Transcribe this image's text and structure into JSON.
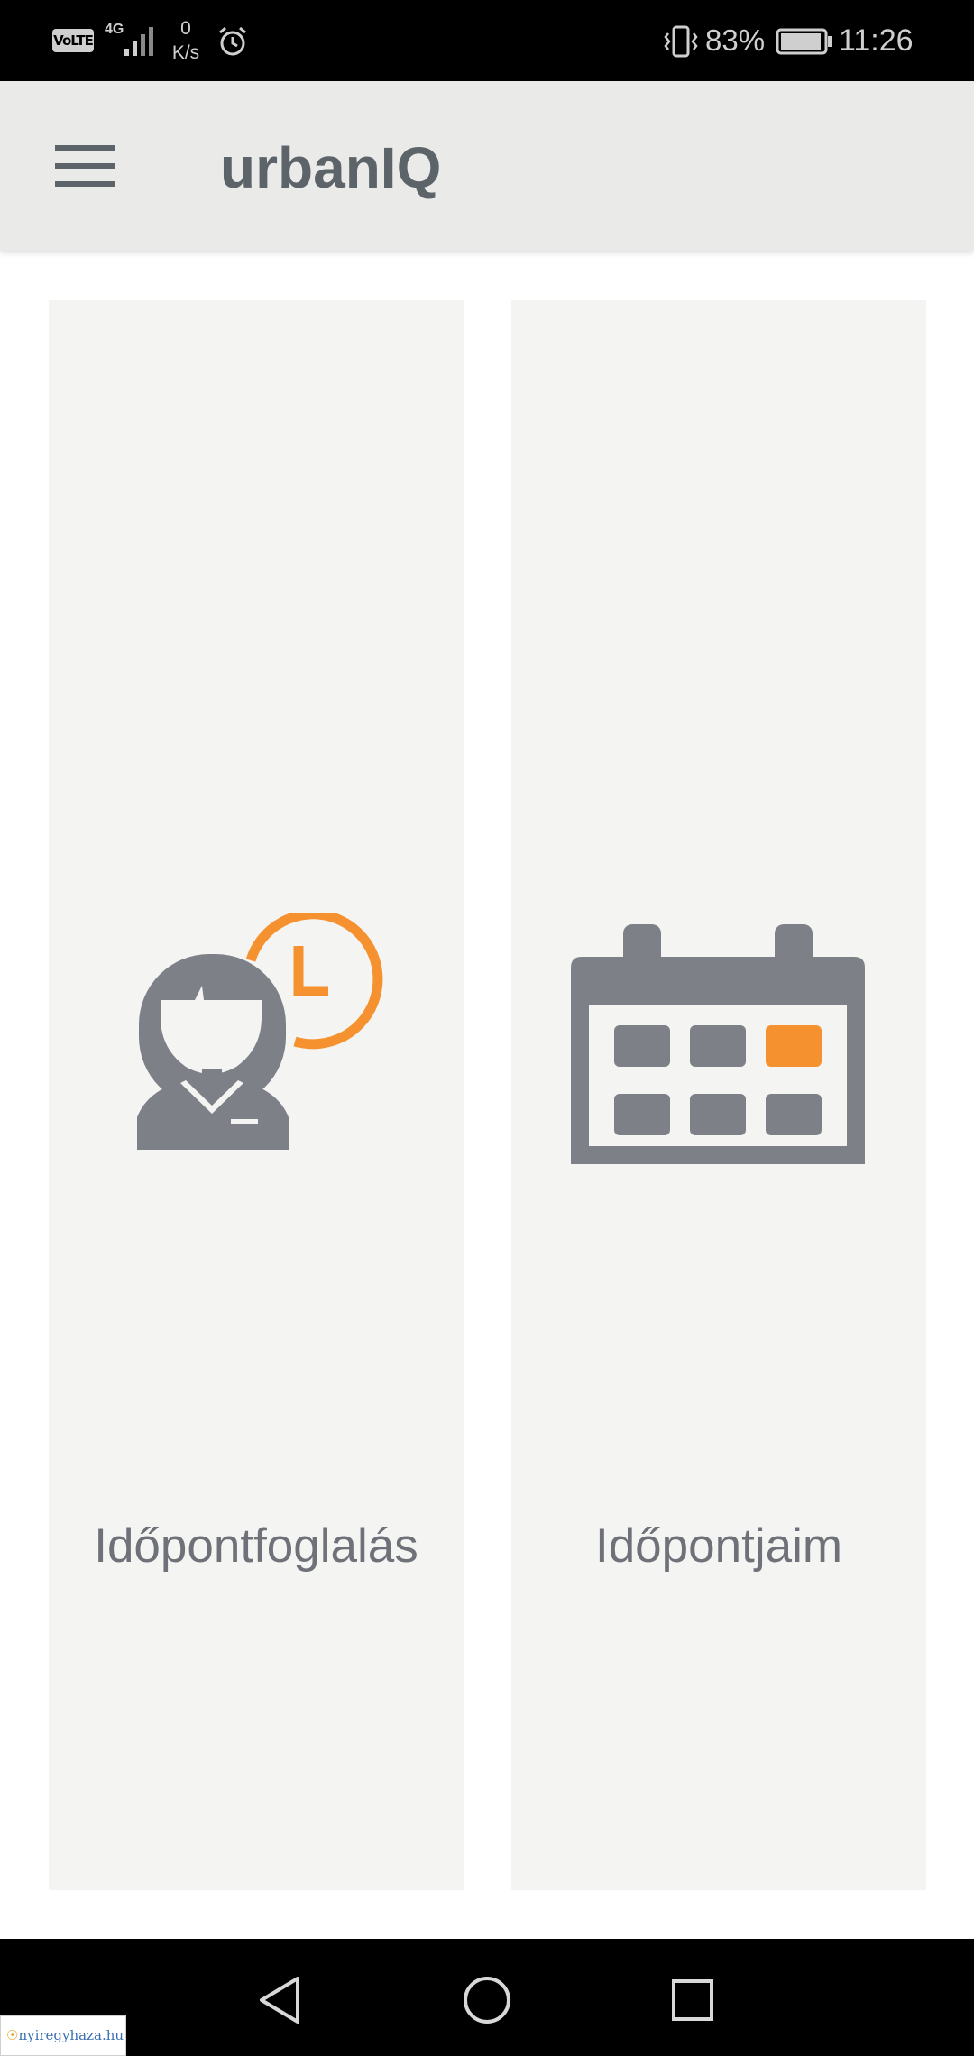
{
  "status_bar": {
    "volte": "VoLTE",
    "network_type": "4G",
    "speed_value": "0",
    "speed_unit": "K/s",
    "battery_percent": "83%",
    "time": "11:26"
  },
  "app_bar": {
    "title": "urbanIQ",
    "menu_icon": "hamburger-menu-icon"
  },
  "tiles": [
    {
      "label": "Időpontfoglalás",
      "icon": "person-clock-icon"
    },
    {
      "label": "Időpontjaim",
      "icon": "calendar-icon"
    }
  ],
  "colors": {
    "app_bar_bg": "#eaebe8",
    "tile_bg": "#f4f4f3",
    "icon_gray": "#7d8087",
    "accent_orange": "#f5922f",
    "title_text": "#5d6469"
  },
  "nav_bar": {
    "back_icon": "back-triangle-icon",
    "home_icon": "home-circle-icon",
    "recents_icon": "recents-square-icon"
  },
  "watermark": {
    "text": "nyiregyhaza.hu"
  }
}
